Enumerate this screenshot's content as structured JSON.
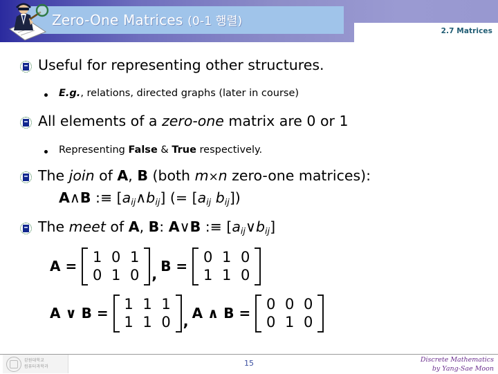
{
  "header": {
    "title_main": "Zero-One Matrices ",
    "title_paren": "(0-1 행렬)",
    "section_label": "2.7 Matrices",
    "icon_name": "detective-with-magnifier-icon",
    "band_color": "#8d8dc8",
    "title_bar_color": "#a0c4ea",
    "section_label_color": "#1f5c73"
  },
  "body": {
    "b1": "Useful for representing other structures.",
    "b1s1_a": "E.g.",
    "b1s1_b": ", relations, directed graphs (later in course)",
    "b2_a": "All elements of a ",
    "b2_b": "zero-one",
    "b2_c": " matrix are 0 or 1",
    "b2s1_a": "Representing ",
    "b2s1_b": "False",
    "b2s1_c": " & ",
    "b2s1_d": "True",
    "b2s1_e": " respectively.",
    "b3_a": "The ",
    "b3_b": "join",
    "b3_c": " of ",
    "b3_d": "A",
    "b3_e": ", ",
    "b3_f": "B",
    "b3_g": " (both ",
    "b3_h": "m",
    "b3_i": "×",
    "b3_j": "n",
    "b3_k": " zero-one matrices):",
    "b3_formula": {
      "lhs_A": "A",
      "op1": "∧",
      "lhs_B": "B",
      "assign": " :≡ [",
      "a": "a",
      "ij1": "ij",
      "op2": "∧",
      "b": "b",
      "ij2": "ij",
      "close": "] (= [",
      "a2": "a",
      "ij3": "ij",
      "space": " ",
      "b2": "b",
      "ij4": "ij",
      "end": "])"
    },
    "b4_a": "The ",
    "b4_b": "meet",
    "b4_c": " of ",
    "b4_d": "A",
    "b4_e": ", ",
    "b4_f": "B",
    "b4_g": ": ",
    "b4_h": "A",
    "b4_i": "∨",
    "b4_j": "B",
    "b4_k": " :≡ [",
    "b4_l": "a",
    "b4_m": "ij",
    "b4_n": "∨",
    "b4_o": "b",
    "b4_p": "ij",
    "b4_q": "]"
  },
  "matrices": [
    {
      "name": "matrix-A",
      "label": "A =",
      "rows": [
        [
          "1",
          "0",
          "1"
        ],
        [
          "0",
          "1",
          "0"
        ]
      ],
      "trailing": ","
    },
    {
      "name": "matrix-B",
      "label": "B =",
      "rows": [
        [
          "0",
          "1",
          "0"
        ],
        [
          "1",
          "1",
          "0"
        ]
      ],
      "trailing": ""
    },
    {
      "name": "matrix-A-meet-B",
      "label": "A ∨ B =",
      "rows": [
        [
          "1",
          "1",
          "1"
        ],
        [
          "1",
          "1",
          "0"
        ]
      ],
      "trailing": ","
    },
    {
      "name": "matrix-A-join-B",
      "label": "A ∧ B =",
      "rows": [
        [
          "0",
          "0",
          "0"
        ],
        [
          "0",
          "1",
          "0"
        ]
      ],
      "trailing": ""
    }
  ],
  "footer": {
    "page_number": "15",
    "credit_line1": "Discrete Mathematics",
    "credit_line2": "by Yang-Sae Moon",
    "logo_ko_line1": "강원대학교",
    "logo_ko_line2": "컴퓨터과학과",
    "page_number_color": "#3b4fa0",
    "credit_color": "#6b2f8e"
  }
}
